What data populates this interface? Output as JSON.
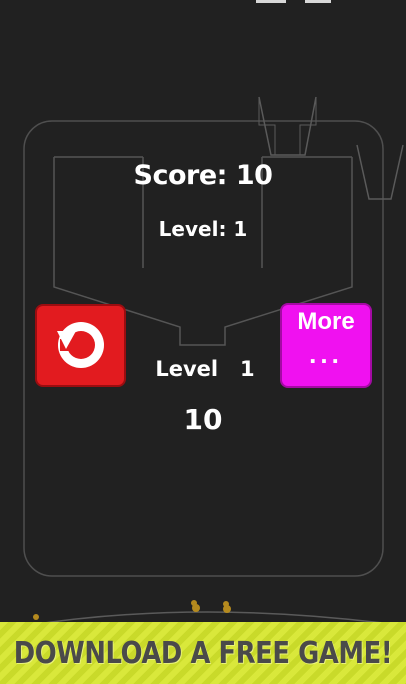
{
  "hud": {
    "score_label": "Score: 10",
    "level_label": "Level: 1"
  },
  "result": {
    "level_text": "Level   1",
    "score_value": "10"
  },
  "buttons": {
    "restart_icon": "restart-icon",
    "more_label": "More",
    "more_dots": "..."
  },
  "banner": {
    "text": "DOWNLOAD A FREE GAME!"
  },
  "colors": {
    "background": "#212121",
    "restart": "#e21b1f",
    "more": "#f011f0",
    "banner": "#d9e83b",
    "outline": "#555555"
  }
}
